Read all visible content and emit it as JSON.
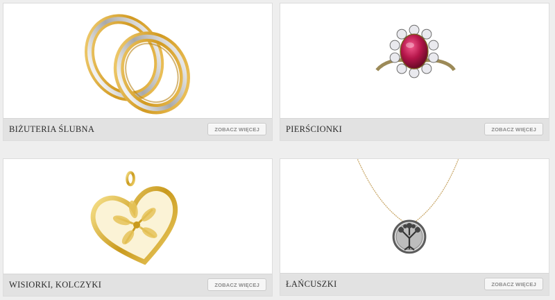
{
  "categories": [
    {
      "title": "BIŻUTERIA ŚLUBNA",
      "button": "ZOBACZ WIĘCEJ",
      "image_icon": "wedding-rings-icon"
    },
    {
      "title": "PIERŚCIONKI",
      "button": "ZOBACZ WIĘCEJ",
      "image_icon": "ruby-ring-icon"
    },
    {
      "title": "WISIORKI, KOLCZYKI",
      "button": "ZOBACZ WIĘCEJ",
      "image_icon": "heart-pendant-icon"
    },
    {
      "title": "ŁAŃCUSZKI",
      "button": "ZOBACZ WIĘCEJ",
      "image_icon": "tree-pendant-necklace-icon"
    }
  ],
  "colors": {
    "page_bg": "#eeeeee",
    "card_bg": "#ffffff",
    "footer_bg": "#e2e2e2",
    "gold": "#d9a42e",
    "white_gold": "#d8d8d8",
    "ruby": "#b5164a"
  }
}
